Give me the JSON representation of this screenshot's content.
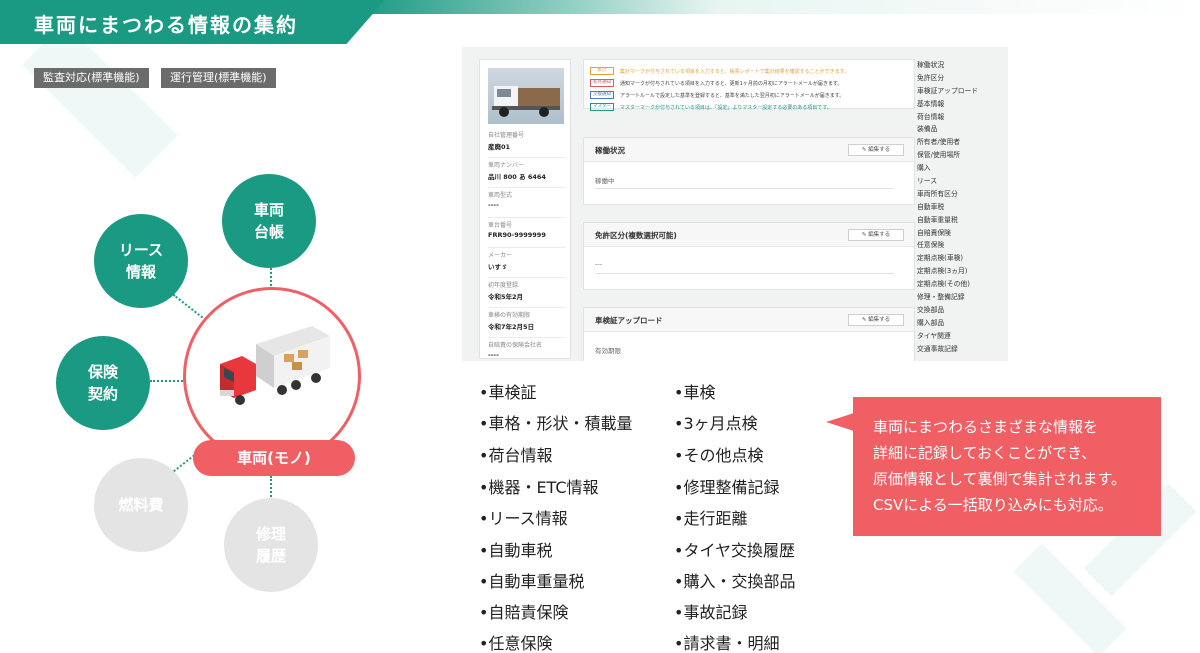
{
  "header": {
    "title": "車両にまつわる情報の集約"
  },
  "tags": [
    "監査対応(標準機能)",
    "運行管理(標準機能)"
  ],
  "diagram": {
    "center_label": "車両(モノ)",
    "nodes": [
      {
        "label": "車両\n台帳",
        "active": true
      },
      {
        "label": "リース\n情報",
        "active": true
      },
      {
        "label": "保険\n契約",
        "active": true
      },
      {
        "label": "燃料費",
        "active": false
      },
      {
        "label": "修理\n履歴",
        "active": false
      }
    ]
  },
  "screenshot": {
    "vehicle_card": {
      "fields": [
        {
          "key": "自社管理番号",
          "value": "産廃01"
        },
        {
          "key": "車両ナンバー",
          "value": "品川 800 あ 6464"
        },
        {
          "key": "車両型式",
          "value": "----"
        },
        {
          "key": "車台番号",
          "value": "FRR90-9999999"
        },
        {
          "key": "メーカー",
          "value": "いすゞ"
        },
        {
          "key": "初年度登録",
          "value": "令和5年2月"
        },
        {
          "key": "車検の有効期限",
          "value": "令和7年2月5日"
        },
        {
          "key": "自賠責の保険会社名",
          "value": "----"
        }
      ]
    },
    "notices": [
      {
        "badge": "集計",
        "color": "#e8a23a",
        "text": "集計マークが付与されている項目を入力すると、帳票レポートで集計結果を確認することができます。"
      },
      {
        "badge": "初月通知",
        "color": "#e0585c",
        "text": "通知マークが付与されている項目を入力すると、更新1ヶ月前の月初にアラートメールが届きます。"
      },
      {
        "badge": "交換通知",
        "color": "#4a78c2",
        "text": "アラートルールで設定した基準を登録すると、基準を満たした翌月初にアラートメールが届きます。"
      },
      {
        "badge": "マスター",
        "color": "#1a9a82",
        "text": "マスターマークが付与されている項目は、「設定」よりマスター設定する必要のある項目です。"
      }
    ],
    "sections": [
      {
        "title": "稼働状況",
        "edit": "編集する",
        "value": "稼働中"
      },
      {
        "title": "免許区分(複数選択可能)",
        "edit": "編集する",
        "value": "---"
      },
      {
        "title": "車検証アップロード",
        "edit": "編集する",
        "value": "有効期限"
      }
    ],
    "nav": [
      "稼働状況",
      "免許区分",
      "車検証アップロード",
      "基本情報",
      "荷台情報",
      "装備品",
      "所有者/使用者",
      "保管/使用場所",
      "購入",
      "リース",
      "車両所有区分",
      "自動車税",
      "自動車重量税",
      "自賠責保険",
      "任意保険",
      "定期点検(車検)",
      "定期点検(3ヵ月)",
      "定期点検(その他)",
      "修理・整備記録",
      "交換部品",
      "購入部品",
      "タイヤ関連",
      "交通事故記録"
    ]
  },
  "features": {
    "col1": [
      "•車検証",
      "•車格・形状・積載量",
      "•荷台情報",
      "•機器・ETC情報",
      "•リース情報",
      "•自動車税",
      "•自動車重量税",
      "•自賠責保険",
      "•任意保険"
    ],
    "col2": [
      "•車検",
      "•3ヶ月点検",
      "•その他点検",
      "•修理整備記録",
      "•走行距離",
      "•タイヤ交換履歴",
      "•購入・交換部品",
      "•事故記録",
      "•請求書・明細"
    ]
  },
  "callout": {
    "lines": [
      "車両にまつわるさまざまな情報を",
      "詳細に記録しておくことができ、",
      "原価情報として裏側で集計されます。",
      "CSVによる一括取り込みにも対応。"
    ]
  },
  "colors": {
    "accent_green": "#1a9a82",
    "accent_red": "#ef5f63",
    "inactive_grey": "#e4e4e4"
  }
}
